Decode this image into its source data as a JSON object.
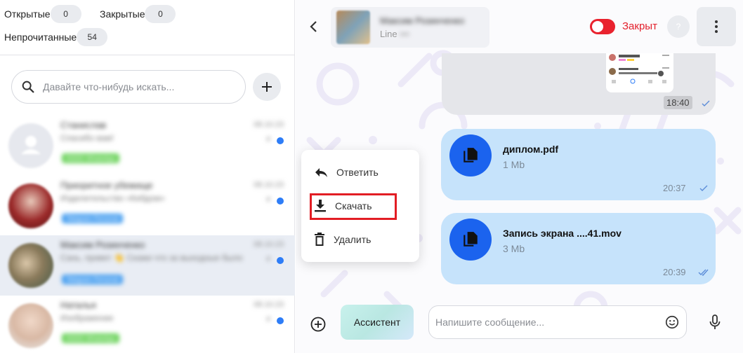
{
  "filters": {
    "open_label": "Открытые",
    "open_count": "0",
    "closed_label": "Закрытые",
    "closed_count": "0",
    "unread_label": "Непрочитанные",
    "unread_count": "54"
  },
  "search": {
    "placeholder": "Давайте что-нибудь искать..."
  },
  "chats": [
    {
      "name": "Станислав",
      "time": "08.10.23",
      "preview": "Спасибо вам!",
      "tag": "DDDD WhatsApp",
      "tag_color": "#6cd35c",
      "unread_num": "4"
    },
    {
      "name": "Приоритное убежище",
      "time": "08.10.23",
      "preview": "Изделительство «Кибдом»",
      "tag": "Telegram Personal",
      "tag_color": "#4aa0f0",
      "unread_num": "4"
    },
    {
      "name": "Максим Розинченко",
      "time": "08.10.23",
      "preview": "Сань, привет 👋 Скажи что за выходные было",
      "tag": "Telegram Personal",
      "tag_color": "#4aa0f0",
      "unread_num": "4"
    },
    {
      "name": "Наталья",
      "time": "08.10.23",
      "preview": "Изображение",
      "tag": "DDDD WhatsApp",
      "tag_color": "#6cd35c",
      "unread_num": "4"
    }
  ],
  "header": {
    "contact_name": "Максим Розинченко",
    "contact_sub": "Line",
    "status_label": "Закрыт",
    "help_label": "?"
  },
  "messages": {
    "image_time": "18:40",
    "files": [
      {
        "name": "диплом.pdf",
        "size": "1 Mb",
        "time": "20:37"
      },
      {
        "name": "Запись экрана ....41.mov",
        "size": "3 Mb",
        "time": "20:39"
      }
    ]
  },
  "context_menu": {
    "reply": "Ответить",
    "download": "Скачать",
    "delete": "Удалить"
  },
  "composer": {
    "assistant_label": "Ассистент",
    "placeholder": "Напишите сообщение..."
  },
  "colors": {
    "accent_blue": "#1b63ee",
    "bubble_blue": "#c6e3fb",
    "status_red": "#e3202c",
    "highlight_red": "#e21d24"
  },
  "icons": [
    "search-icon",
    "plus-icon",
    "back-arrow-icon",
    "more-vertical-icon",
    "file-icon",
    "reply-icon",
    "download-icon",
    "trash-icon",
    "add-circle-icon",
    "emoji-icon",
    "microphone-icon",
    "check-icon",
    "double-check-icon"
  ]
}
